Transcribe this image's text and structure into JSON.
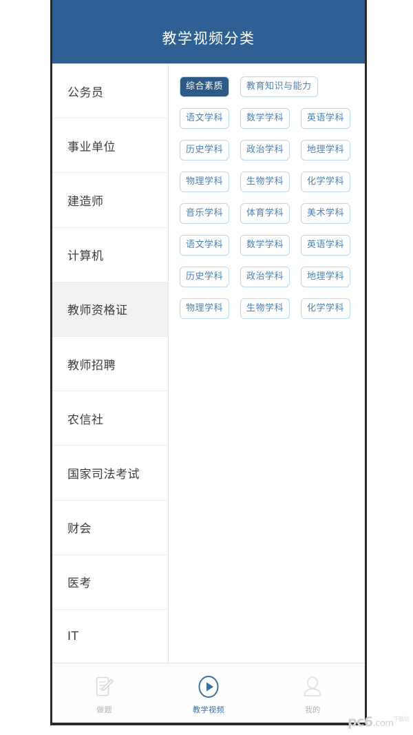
{
  "header": {
    "title": "教学视频分类",
    "background_color": "#2e6094",
    "text_color": "#ffffff"
  },
  "sidebar": {
    "selected_index": 4,
    "items": [
      {
        "label": "公务员"
      },
      {
        "label": "事业单位"
      },
      {
        "label": "建造师"
      },
      {
        "label": "计算机"
      },
      {
        "label": "教师资格证"
      },
      {
        "label": "教师招聘"
      },
      {
        "label": "农信社"
      },
      {
        "label": "国家司法考试"
      },
      {
        "label": "财会"
      },
      {
        "label": "医考"
      },
      {
        "label": "IT"
      }
    ]
  },
  "tags": {
    "selected_label": "综合素质",
    "chip_border_color": "#bcd8ec",
    "chip_text_color": "#4b81b6",
    "chip_selected_background": "#2e5886",
    "rows": [
      [
        {
          "label": "综合素质",
          "selected": true
        },
        {
          "label": "教育知识与能力",
          "selected": false
        }
      ],
      [
        {
          "label": "语文学科",
          "selected": false
        },
        {
          "label": "数学学科",
          "selected": false
        },
        {
          "label": "英语学科",
          "selected": false
        }
      ],
      [
        {
          "label": "历史学科",
          "selected": false
        },
        {
          "label": "政治学科",
          "selected": false
        },
        {
          "label": "地理学科",
          "selected": false
        }
      ],
      [
        {
          "label": "物理学科",
          "selected": false
        },
        {
          "label": "生物学科",
          "selected": false
        },
        {
          "label": "化学学科",
          "selected": false
        }
      ],
      [
        {
          "label": "音乐学科",
          "selected": false
        },
        {
          "label": "体育学科",
          "selected": false
        },
        {
          "label": "美术学科",
          "selected": false
        }
      ],
      [
        {
          "label": "语文学科",
          "selected": false
        },
        {
          "label": "数学学科",
          "selected": false
        },
        {
          "label": "英语学科",
          "selected": false
        }
      ],
      [
        {
          "label": "历史学科",
          "selected": false
        },
        {
          "label": "政治学科",
          "selected": false
        },
        {
          "label": "地理学科",
          "selected": false
        }
      ],
      [
        {
          "label": "物理学科",
          "selected": false
        },
        {
          "label": "生物学科",
          "selected": false
        },
        {
          "label": "化学学科",
          "selected": false
        }
      ]
    ]
  },
  "bottom_nav": {
    "active_index": 1,
    "active_color": "#3a6ea5",
    "inactive_color": "#b4b4b4",
    "items": [
      {
        "label": "做题",
        "icon": "note-pencil-icon",
        "active": false
      },
      {
        "label": "教学视频",
        "icon": "play-circle-icon",
        "active": true
      },
      {
        "label": "我的",
        "icon": "person-icon",
        "active": false
      }
    ]
  },
  "watermark": {
    "brand": "pc6",
    "domain": ".com",
    "suffix": "下载站"
  }
}
